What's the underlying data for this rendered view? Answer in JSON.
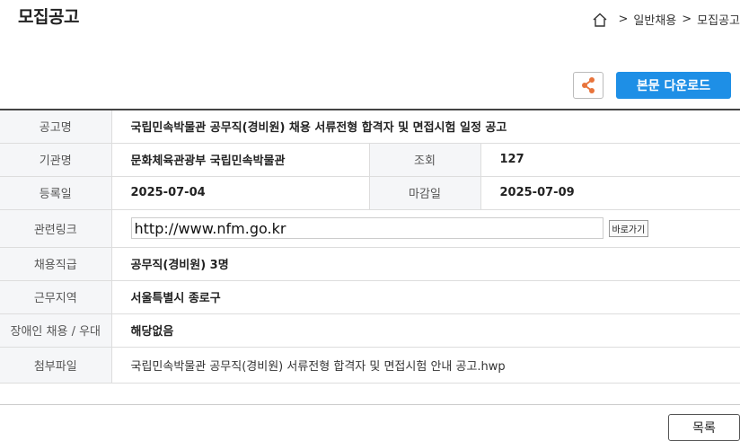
{
  "page": {
    "title": "모집공고"
  },
  "breadcrumb": {
    "items": [
      "일반채용",
      "모집공고"
    ]
  },
  "actions": {
    "download_label": "본문 다운로드"
  },
  "colors": {
    "accent": "#1e8fe6",
    "share_icon": "#e8743b"
  },
  "fields": {
    "title_label": "공고명",
    "title_value": "국립민속박물관 공무직(경비원) 채용 서류전형 합격자 및 면접시험 일정 공고",
    "agency_label": "기관명",
    "agency_value": "문화체육관광부 국립민속박물관",
    "views_label": "조회",
    "views_value": "127",
    "reg_label": "등록일",
    "reg_value": "2025-07-04",
    "deadline_label": "마감일",
    "deadline_value": "2025-07-09",
    "link_label": "관련링크",
    "link_value": "http://www.nfm.go.kr",
    "link_go_label": "바로가기",
    "job_label": "채용직급",
    "job_value": "공무직(경비원) 3명",
    "region_label": "근무지역",
    "region_value": "서울특별시 종로구",
    "disabled_label": "장애인 채용 / 우대",
    "disabled_value": "해당없음",
    "attach_label": "첨부파일",
    "attach_value": "국립민속박물관 공무직(경비원) 서류전형 합격자 및 면접시험 안내 공고.hwp"
  },
  "footer": {
    "list_label": "목록"
  }
}
